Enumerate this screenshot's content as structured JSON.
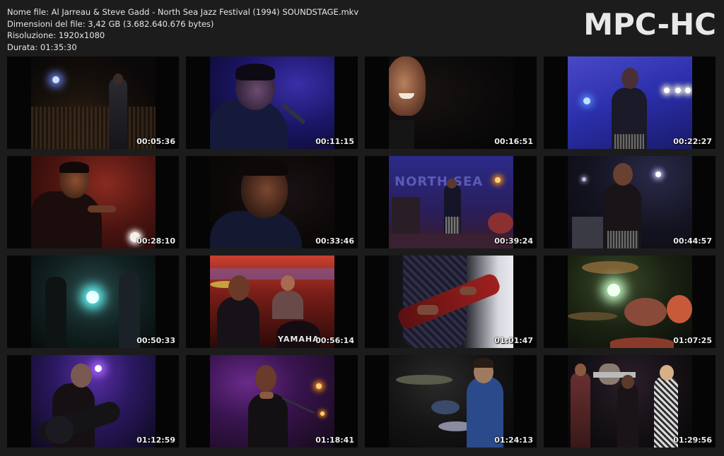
{
  "info": {
    "filename": "Nome file: Al Jarreau & Steve Gadd - North Sea Jazz Festival (1994) SOUNDSTAGE.mkv",
    "filesize": "Dimensioni del file: 3,42 GB (3.682.640.676 bytes)",
    "resolution": "Risoluzione: 1920x1080",
    "duration": "Durata: 01:35:30"
  },
  "logo": "MPC-HC",
  "thumbnails": [
    {
      "time": "00:05:36",
      "scene": "concert-crowd-singer"
    },
    {
      "time": "00:11:15",
      "scene": "singer-blue-light"
    },
    {
      "time": "00:16:51",
      "scene": "singer-closeup-smile"
    },
    {
      "time": "00:22:27",
      "scene": "singer-stage-lights"
    },
    {
      "time": "00:28:10",
      "scene": "singer-red-light"
    },
    {
      "time": "00:33:46",
      "scene": "singer-closeup-dark"
    },
    {
      "time": "00:39:24",
      "scene": "band-north-sea-stage"
    },
    {
      "time": "00:44:57",
      "scene": "female-singer-mic"
    },
    {
      "time": "00:50:33",
      "scene": "stage-spotlight"
    },
    {
      "time": "00:56:14",
      "scene": "singer-drummer-yamaha"
    },
    {
      "time": "01:01:47",
      "scene": "guitarist-closeup"
    },
    {
      "time": "01:07:25",
      "scene": "drum-kit-lights"
    },
    {
      "time": "01:12:59",
      "scene": "acoustic-guitarist-purple"
    },
    {
      "time": "01:18:41",
      "scene": "singer-purple-mic"
    },
    {
      "time": "01:24:13",
      "scene": "drummer-playing"
    },
    {
      "time": "01:29:56",
      "scene": "backing-singers"
    }
  ],
  "colors": {
    "background": "#1c1c1c",
    "text": "#e6e6e6",
    "thumb_bg": "#050505"
  },
  "yamaha_text": "YAMAHA",
  "north_sea_text": "NORTH SEA"
}
